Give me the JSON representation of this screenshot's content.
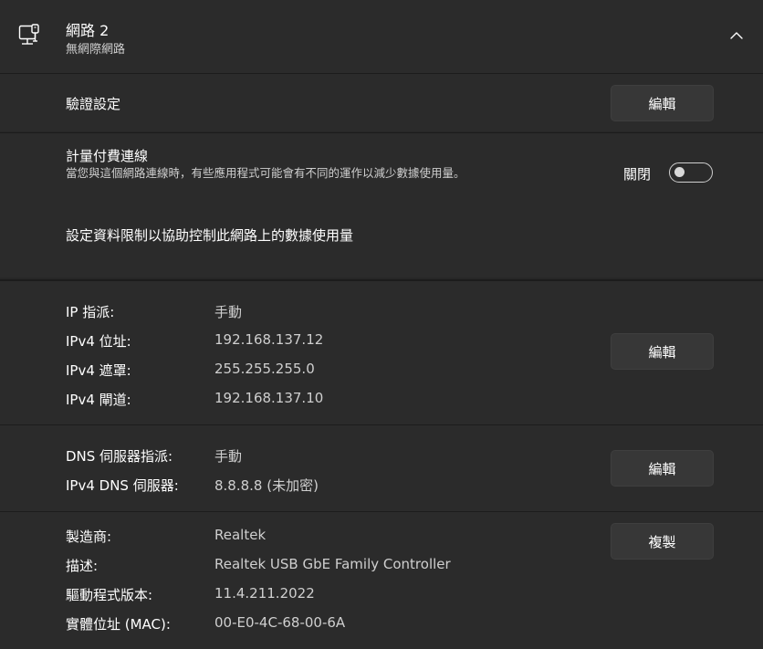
{
  "header": {
    "title": "網路 2",
    "subtitle": "無網際網路",
    "icon": "network-pc-icon",
    "collapse_icon": "chevron-up-icon"
  },
  "auth": {
    "label": "驗證設定",
    "button": "編輯"
  },
  "metered": {
    "label": "計量付費連線",
    "description": "當您與這個網路連線時，有些應用程式可能會有不同的運作以減少數據使用量。",
    "toggle_label": "關閉",
    "toggle_on": false,
    "data_limit_link": "設定資料限制以協助控制此網路上的數據使用量"
  },
  "ip": {
    "rows": [
      {
        "label": "IP 指派:",
        "value": "手動"
      },
      {
        "label": "IPv4 位址:",
        "value": "192.168.137.12"
      },
      {
        "label": "IPv4 遮罩:",
        "value": "255.255.255.0"
      },
      {
        "label": "IPv4 閘道:",
        "value": "192.168.137.10"
      }
    ],
    "button": "編輯"
  },
  "dns": {
    "rows": [
      {
        "label": "DNS 伺服器指派:",
        "value": "手動"
      },
      {
        "label": "IPv4 DNS 伺服器:",
        "value": "8.8.8.8 (未加密)"
      }
    ],
    "button": "編輯"
  },
  "hardware": {
    "rows": [
      {
        "label": "製造商:",
        "value": "Realtek"
      },
      {
        "label": "描述:",
        "value": "Realtek USB GbE Family Controller"
      },
      {
        "label": "驅動程式版本:",
        "value": "11.4.211.2022"
      },
      {
        "label": "實體位址 (MAC):",
        "value": "00-E0-4C-68-00-6A"
      }
    ],
    "button": "複製"
  },
  "colors": {
    "background": "#272727",
    "card": "#2b2b2b",
    "button": "#373737",
    "secondary_text": "#cfcfcf"
  }
}
